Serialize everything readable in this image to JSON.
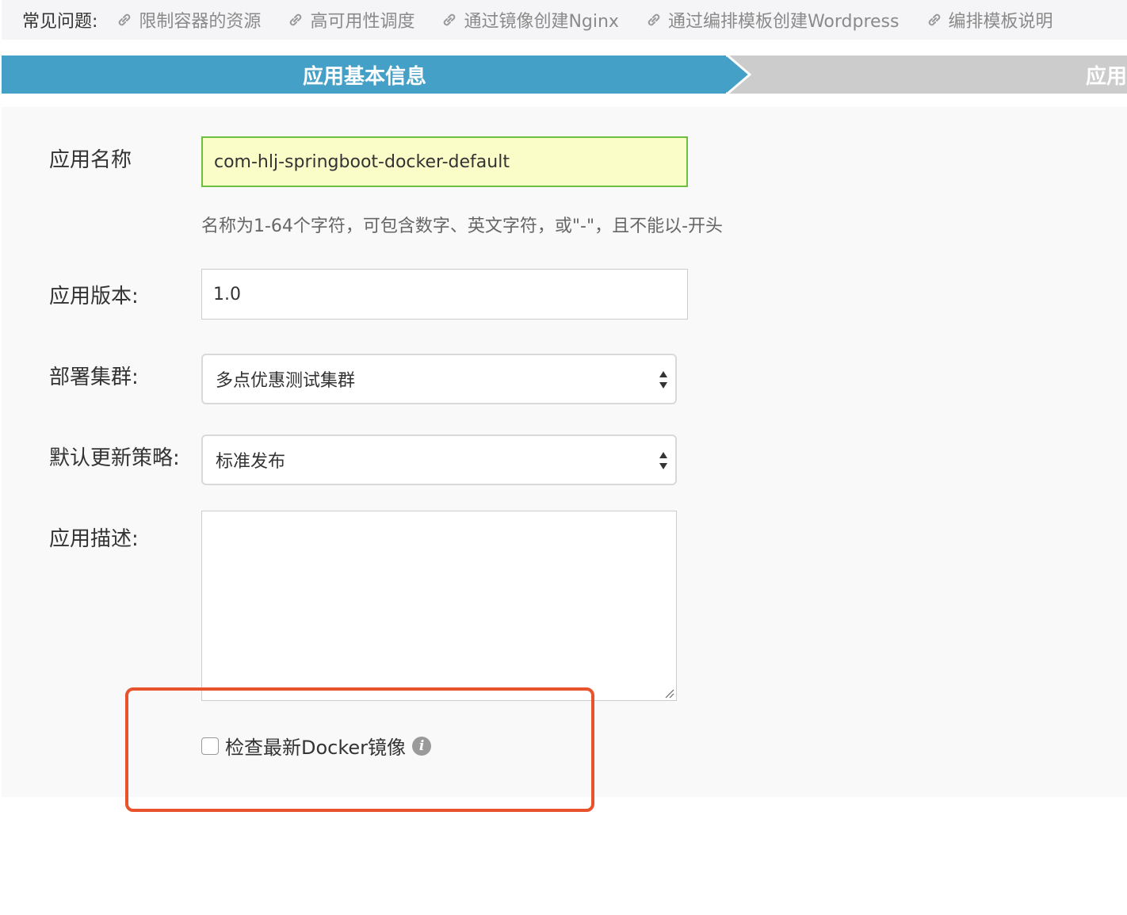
{
  "faq": {
    "label": "常见问题:",
    "links": [
      "限制容器的资源",
      "高可用性调度",
      "通过镜像创建Nginx",
      "通过编排模板创建Wordpress",
      "编排模板说明"
    ],
    "link_icon": "link-icon"
  },
  "steps": {
    "active": "应用基本信息",
    "next": "应用",
    "active_color": "#44a0c6",
    "inactive_color": "#cccccc"
  },
  "form": {
    "name_label": "应用名称",
    "name_value": "com-hlj-springboot-docker-default",
    "name_hint": "名称为1-64个字符，可包含数字、英文字符，或\"-\"，且不能以-开头",
    "version_label": "应用版本:",
    "version_value": "1.0",
    "cluster_label": "部署集群:",
    "cluster_value": "多点优惠测试集群",
    "strategy_label": "默认更新策略:",
    "strategy_value": "标准发布",
    "desc_label": "应用描述:",
    "desc_value": "",
    "check_label": "检查最新Docker镜像",
    "info_glyph": "i"
  },
  "colors": {
    "highlight": "#e8532d",
    "name_border": "#6cbf3f",
    "name_bg": "#fbfdc8"
  }
}
